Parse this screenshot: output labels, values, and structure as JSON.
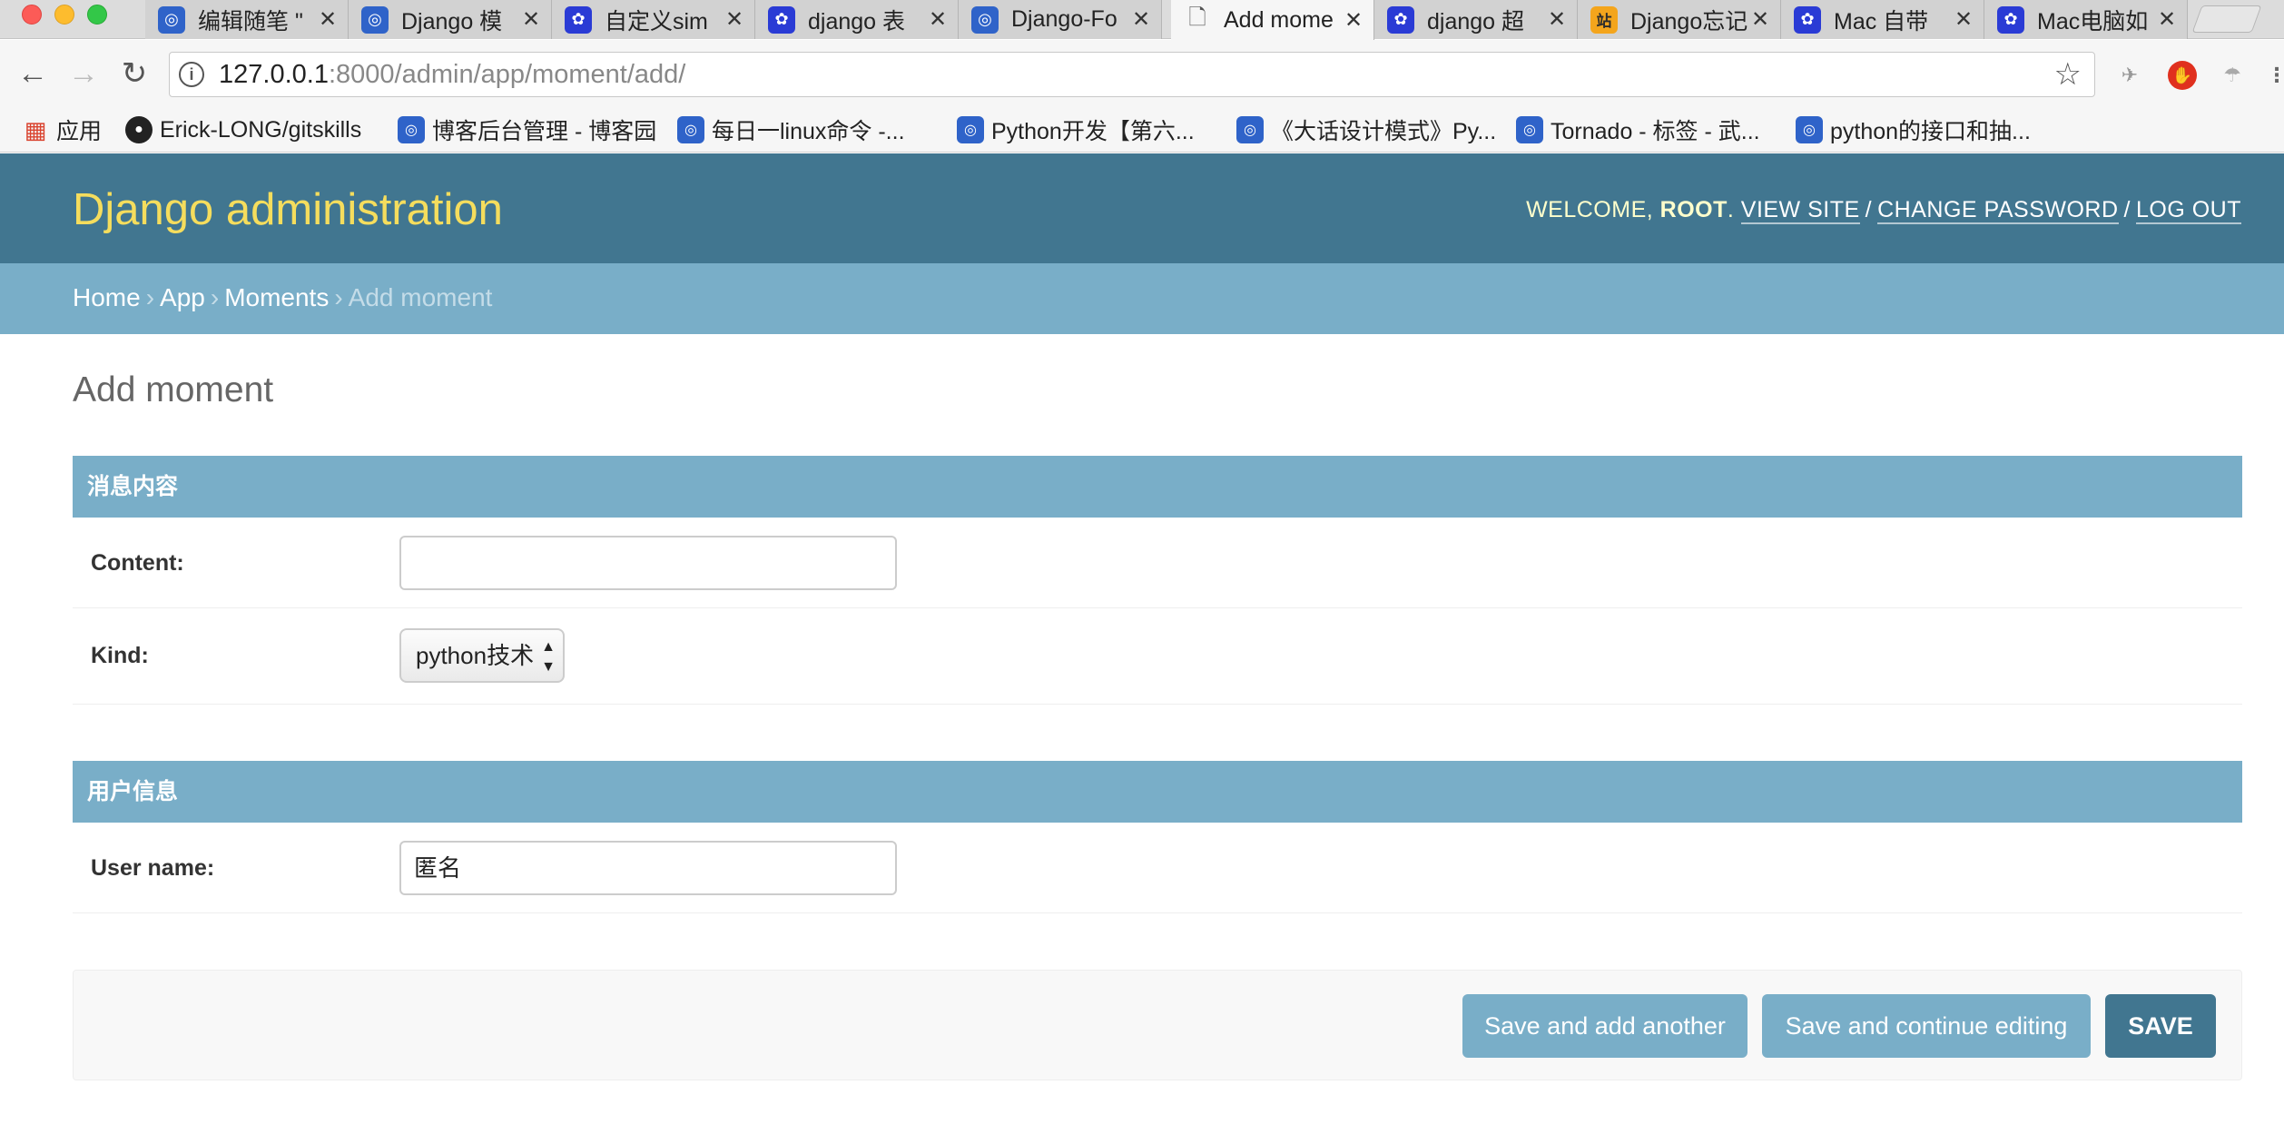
{
  "browser": {
    "tabs": [
      {
        "title": "编辑随笔 \"",
        "favicon": "cnblogs-icon"
      },
      {
        "title": "Django 模",
        "favicon": "cnblogs-icon"
      },
      {
        "title": "自定义sim",
        "favicon": "baidu-paw-icon"
      },
      {
        "title": "django 表",
        "favicon": "baidu-paw-icon"
      },
      {
        "title": "Django-Fo",
        "favicon": "cnblogs-icon"
      },
      {
        "title": "Add mome",
        "favicon": "document-icon",
        "active": true
      },
      {
        "title": "django 超",
        "favicon": "baidu-paw-icon"
      },
      {
        "title": "Django忘记",
        "favicon": "zhan-icon"
      },
      {
        "title": "Mac 自带",
        "favicon": "baidu-paw-icon"
      },
      {
        "title": "Mac电脑如",
        "favicon": "baidu-paw-icon"
      }
    ],
    "url_host": "127.0.0.1",
    "url_rest": ":8000/admin/app/moment/add/",
    "bookmarks": [
      {
        "label": "应用"
      },
      {
        "label": "Erick-LONG/gitskills"
      },
      {
        "label": "博客后台管理 - 博客园"
      },
      {
        "label": "每日一linux命令 -..."
      },
      {
        "label": "Python开发【第六..."
      },
      {
        "label": "《大话设计模式》Py..."
      },
      {
        "label": "Tornado - 标签 - 武..."
      },
      {
        "label": "python的接口和抽..."
      }
    ]
  },
  "admin": {
    "branding": "Django administration",
    "usertools": {
      "welcome": "WELCOME,",
      "username": "ROOT",
      "view_site": "VIEW SITE",
      "change_password": "CHANGE PASSWORD",
      "log_out": "LOG OUT"
    },
    "breadcrumbs": {
      "home": "Home",
      "app": "App",
      "moments": "Moments",
      "current": "Add moment"
    },
    "page_title": "Add moment",
    "fieldsets": [
      {
        "title": "消息内容",
        "content_label": "Content:",
        "content_value": "",
        "kind_label": "Kind:",
        "kind_value": "python技术"
      },
      {
        "title": "用户信息",
        "user_label": "User name:",
        "user_value": "匿名"
      }
    ],
    "buttons": {
      "save_add_another": "Save and add another",
      "save_continue": "Save and continue editing",
      "save": "SAVE"
    }
  }
}
